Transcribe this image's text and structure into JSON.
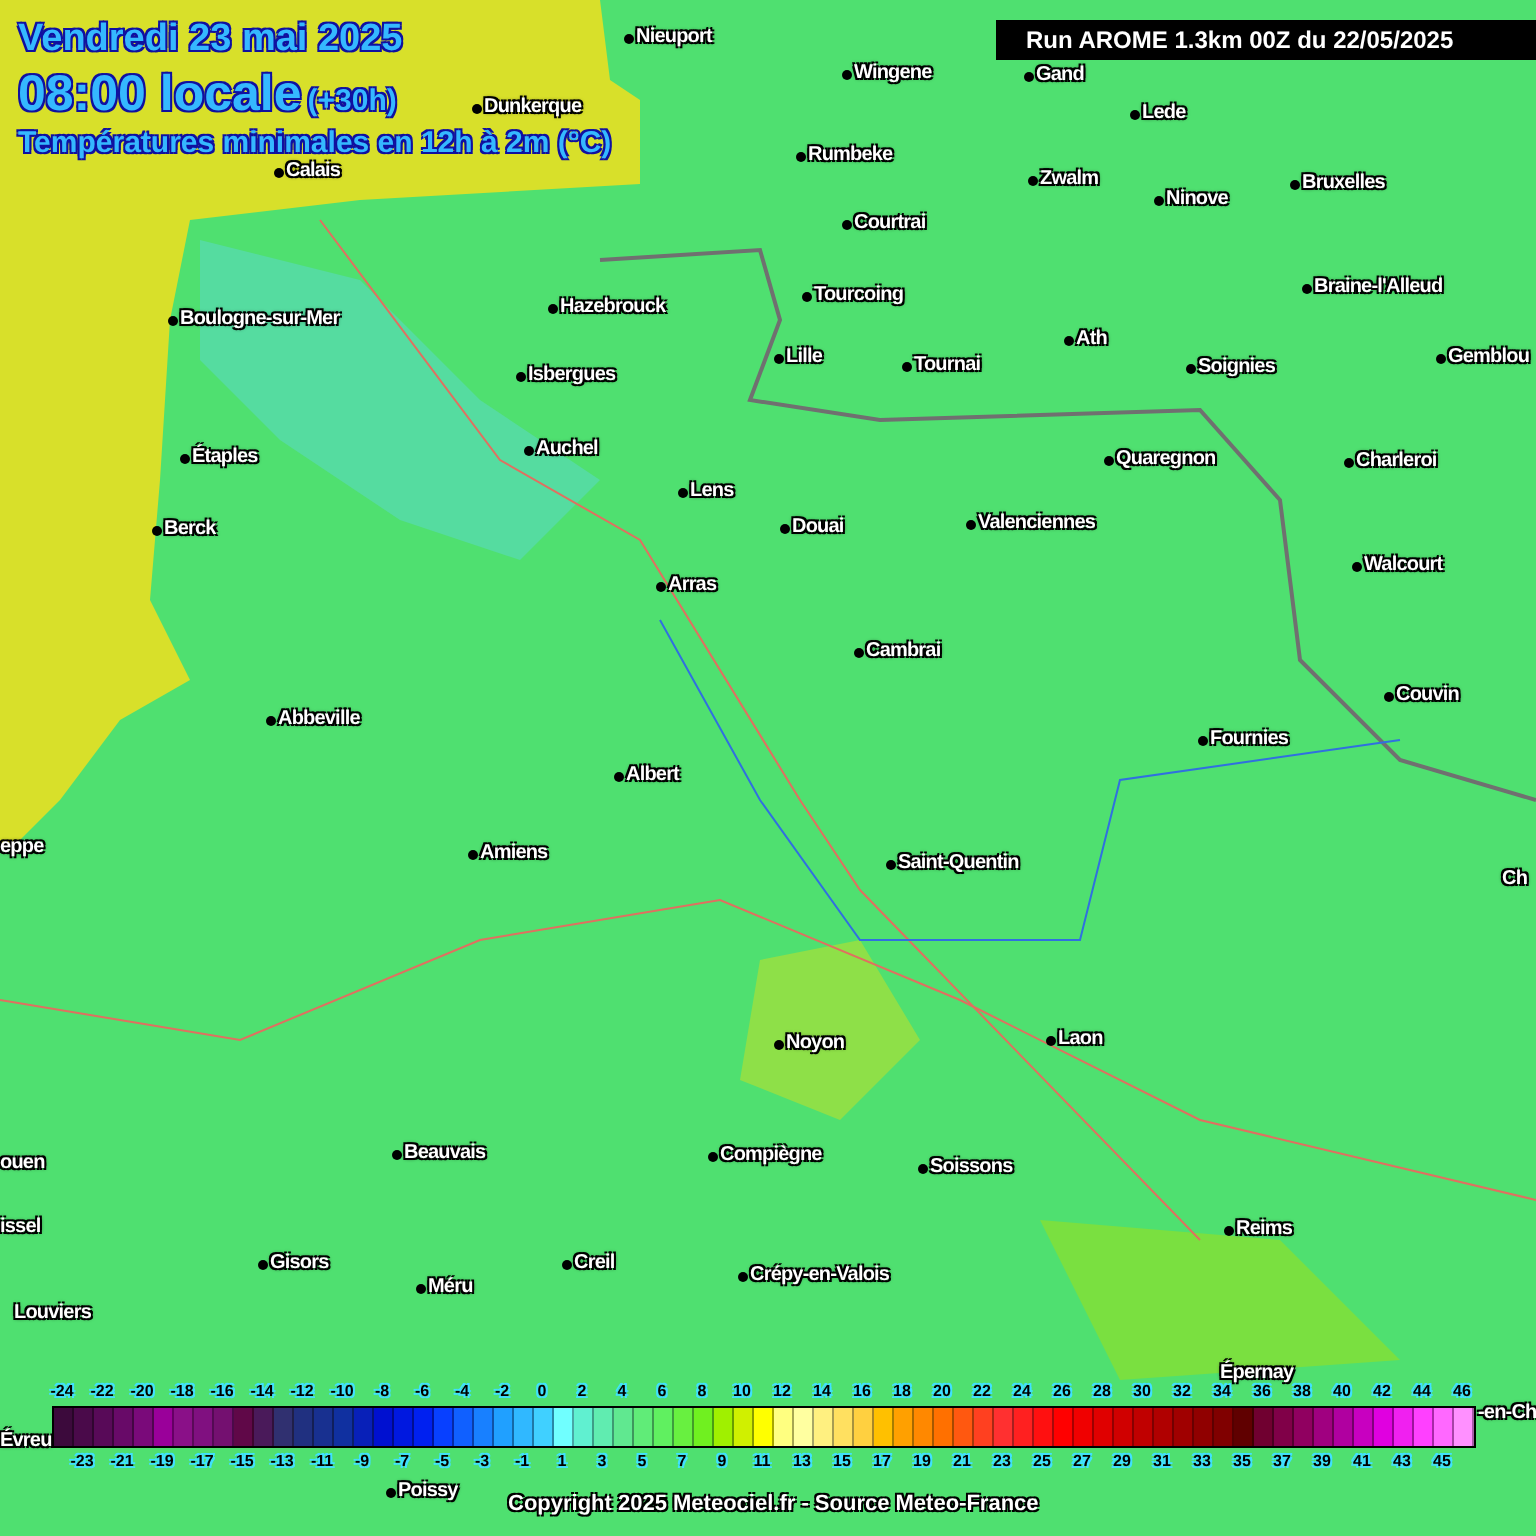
{
  "header": {
    "date": "Vendredi 23 mai 2025",
    "time": "08:00 locale",
    "offset": "(+30h)",
    "subtitle": "Températures minimales en 12h à 2m (°C)"
  },
  "run_info": "Run AROME 1.3km 00Z du 22/05/2025",
  "map": {
    "cities": [
      {
        "name": "Nieuport"
      },
      {
        "name": "Wingene"
      },
      {
        "name": "Gand"
      },
      {
        "name": "Dunkerque"
      },
      {
        "name": "Lede"
      },
      {
        "name": "Calais"
      },
      {
        "name": "Rumbeke"
      },
      {
        "name": "Zwalm"
      },
      {
        "name": "Ninove"
      },
      {
        "name": "Bruxelles"
      },
      {
        "name": "Courtrai"
      },
      {
        "name": "Hazebrouck"
      },
      {
        "name": "Tourcoing"
      },
      {
        "name": "Braine-l'Alleud"
      },
      {
        "name": "Boulogne-sur-Mer"
      },
      {
        "name": "Lille"
      },
      {
        "name": "Tournai"
      },
      {
        "name": "Ath"
      },
      {
        "name": "Soignies"
      },
      {
        "name": "Gemblou"
      },
      {
        "name": "Isbergues"
      },
      {
        "name": "Étaples"
      },
      {
        "name": "Auchel"
      },
      {
        "name": "Quaregnon"
      },
      {
        "name": "Charleroi"
      },
      {
        "name": "Lens"
      },
      {
        "name": "Berck"
      },
      {
        "name": "Douai"
      },
      {
        "name": "Valenciennes"
      },
      {
        "name": "Walcourt"
      },
      {
        "name": "Arras"
      },
      {
        "name": "Cambrai"
      },
      {
        "name": "Couvin"
      },
      {
        "name": "Abbeville"
      },
      {
        "name": "Fournies"
      },
      {
        "name": "Albert"
      },
      {
        "name": "Amiens"
      },
      {
        "name": "Saint-Quentin"
      },
      {
        "name": "eppe"
      },
      {
        "name": "Ch"
      },
      {
        "name": "Noyon"
      },
      {
        "name": "Laon"
      },
      {
        "name": "ouen"
      },
      {
        "name": "Beauvais"
      },
      {
        "name": "Compiègne"
      },
      {
        "name": "Soissons"
      },
      {
        "name": "issel"
      },
      {
        "name": "Reims"
      },
      {
        "name": "Gisors"
      },
      {
        "name": "Creil"
      },
      {
        "name": "Méru"
      },
      {
        "name": "Crépy-en-Valois"
      },
      {
        "name": "Louviers"
      },
      {
        "name": "Épernay"
      },
      {
        "name": "Évreu"
      },
      {
        "name": "-en-Ch"
      },
      {
        "name": "Poissy"
      }
    ]
  },
  "legend": {
    "cells": [
      {
        "color": "#3c0a3c"
      },
      {
        "color": "#4a0a4a"
      },
      {
        "color": "#580a58"
      },
      {
        "color": "#680a68"
      },
      {
        "color": "#7a0a7a"
      },
      {
        "color": "#9a009a"
      },
      {
        "color": "#8a1088"
      },
      {
        "color": "#801080"
      },
      {
        "color": "#741070"
      },
      {
        "color": "#600848"
      },
      {
        "color": "#4a1a5a"
      },
      {
        "color": "#303070"
      },
      {
        "color": "#203080"
      },
      {
        "color": "#183090"
      },
      {
        "color": "#1030a0"
      },
      {
        "color": "#0820b8"
      },
      {
        "color": "#0010d0"
      },
      {
        "color": "#0018e0"
      },
      {
        "color": "#0020f0"
      },
      {
        "color": "#0840ff"
      },
      {
        "color": "#1060ff"
      },
      {
        "color": "#1880ff"
      },
      {
        "color": "#20a0ff"
      },
      {
        "color": "#30b8ff"
      },
      {
        "color": "#40d0ff"
      },
      {
        "color": "#70ffff"
      },
      {
        "color": "#60f0d0"
      },
      {
        "color": "#60ecb0"
      },
      {
        "color": "#60e890"
      },
      {
        "color": "#60ec78"
      },
      {
        "color": "#60f060"
      },
      {
        "color": "#68f040"
      },
      {
        "color": "#70f020"
      },
      {
        "color": "#a0f000"
      },
      {
        "color": "#d0f000"
      },
      {
        "color": "#ffff00"
      },
      {
        "color": "#ffff80"
      },
      {
        "color": "#ffffa0"
      },
      {
        "color": "#fff080"
      },
      {
        "color": "#ffe060"
      },
      {
        "color": "#ffd040"
      },
      {
        "color": "#ffc000"
      },
      {
        "color": "#ffa000"
      },
      {
        "color": "#ff8800"
      },
      {
        "color": "#ff7000"
      },
      {
        "color": "#ff5810"
      },
      {
        "color": "#ff4020"
      },
      {
        "color": "#ff3030"
      },
      {
        "color": "#ff2020"
      },
      {
        "color": "#ff1010"
      },
      {
        "color": "#ff0000"
      },
      {
        "color": "#f00000"
      },
      {
        "color": "#e00000"
      },
      {
        "color": "#d00000"
      },
      {
        "color": "#c00000"
      },
      {
        "color": "#b00000"
      },
      {
        "color": "#a00000"
      },
      {
        "color": "#900000"
      },
      {
        "color": "#800000"
      },
      {
        "color": "#600000"
      },
      {
        "color": "#700030"
      },
      {
        "color": "#800048"
      },
      {
        "color": "#900060"
      },
      {
        "color": "#a00080"
      },
      {
        "color": "#b000a0"
      },
      {
        "color": "#c800c0"
      },
      {
        "color": "#e000e0"
      },
      {
        "color": "#f020f0"
      },
      {
        "color": "#ff40ff"
      },
      {
        "color": "#ff68ff"
      },
      {
        "color": "#ff90ff"
      }
    ],
    "top_labels": [
      "-24",
      "-22",
      "-20",
      "-18",
      "-16",
      "-14",
      "-12",
      "-10",
      "-8",
      "-6",
      "-4",
      "-2",
      "0",
      "2",
      "4",
      "6",
      "8",
      "10",
      "12",
      "14",
      "16",
      "18",
      "20",
      "22",
      "24",
      "26",
      "28",
      "30",
      "32",
      "34",
      "36",
      "38",
      "40",
      "42",
      "44",
      "46"
    ],
    "bottom_labels": [
      "-23",
      "-21",
      "-19",
      "-17",
      "-15",
      "-13",
      "-11",
      "-9",
      "-7",
      "-5",
      "-3",
      "-1",
      "1",
      "3",
      "5",
      "7",
      "9",
      "11",
      "13",
      "15",
      "17",
      "19",
      "21",
      "23",
      "25",
      "27",
      "29",
      "31",
      "33",
      "35",
      "37",
      "39",
      "41",
      "43",
      "45"
    ]
  },
  "copyright": "Copyright 2025 Meteociel.fr - Source Meteo-France"
}
